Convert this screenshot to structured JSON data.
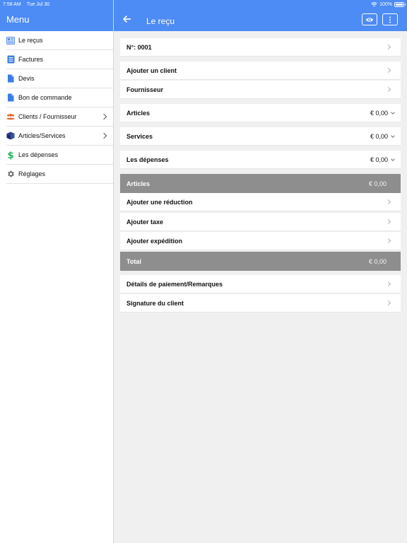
{
  "status": {
    "time": "7:58 AM",
    "date": "Tue Jul 30",
    "battery": "100%"
  },
  "sidebar": {
    "title": "Menu",
    "items": [
      {
        "label": "Le reçus",
        "icon": "receipt-icon",
        "chevron": false
      },
      {
        "label": "Factures",
        "icon": "invoice-icon",
        "chevron": false
      },
      {
        "label": "Devis",
        "icon": "document-icon",
        "chevron": false
      },
      {
        "label": "Bon de commande",
        "icon": "document-icon",
        "chevron": false
      },
      {
        "label": "Clients / Fournisseur",
        "icon": "people-icon",
        "chevron": true
      },
      {
        "label": "Articles/Services",
        "icon": "box-icon",
        "chevron": true
      },
      {
        "label": "Les dépenses",
        "icon": "dollar-icon",
        "chevron": false
      },
      {
        "label": "Réglages",
        "icon": "gear-icon",
        "chevron": false
      }
    ]
  },
  "header": {
    "title": "Le reçu"
  },
  "rows": {
    "number": {
      "label": "N°: 0001"
    },
    "add_client": {
      "label": "Ajouter un client"
    },
    "supplier": {
      "label": "Fournisseur"
    },
    "articles": {
      "label": "Articles",
      "amount": "€ 0,00"
    },
    "services": {
      "label": "Services",
      "amount": "€ 0,00"
    },
    "expenses": {
      "label": "Les dépenses",
      "amount": "€ 0,00"
    },
    "articles_total": {
      "label": "Articles",
      "amount": "€ 0,00"
    },
    "discount": {
      "label": "Ajouter une réduction"
    },
    "tax": {
      "label": "Ajouter taxe"
    },
    "shipping": {
      "label": "Ajouter expédition"
    },
    "total": {
      "label": "Total",
      "amount": "€ 0,00"
    },
    "payment": {
      "label": "Détails de paiement/Remarques"
    },
    "signature": {
      "label": "Signature du client"
    }
  },
  "colors": {
    "header_blue": "#4d8bf5",
    "summary_gray": "#8e8e8e",
    "background": "#f0f0f0"
  }
}
